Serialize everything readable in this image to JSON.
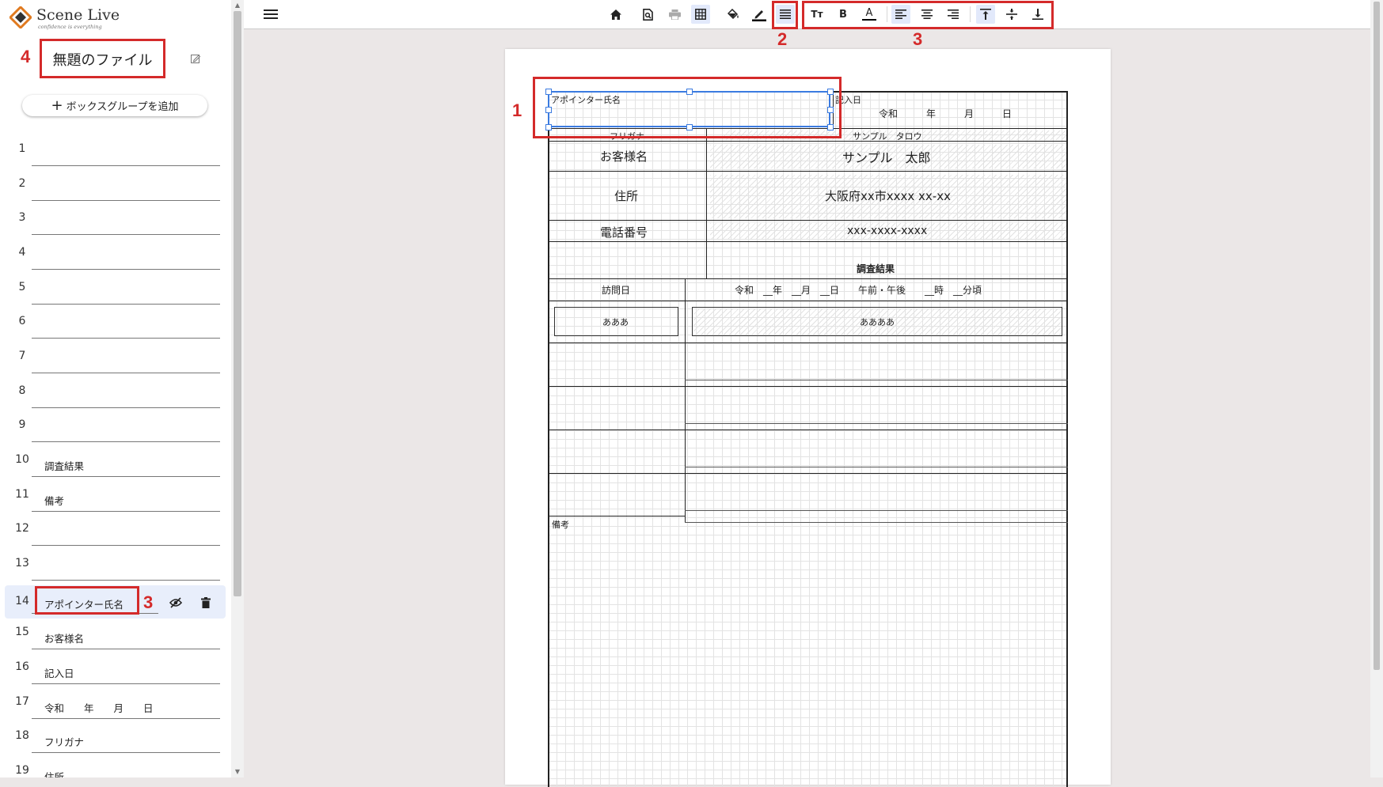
{
  "app": {
    "logo_name": "Scene Live",
    "logo_tagline": "confidence is everything"
  },
  "sidebar": {
    "file_title": "無題のファイル",
    "add_group_label": "ボックスグループを追加",
    "rows": [
      {
        "num": "1",
        "value": ""
      },
      {
        "num": "2",
        "value": ""
      },
      {
        "num": "3",
        "value": ""
      },
      {
        "num": "4",
        "value": ""
      },
      {
        "num": "5",
        "value": ""
      },
      {
        "num": "6",
        "value": ""
      },
      {
        "num": "7",
        "value": ""
      },
      {
        "num": "8",
        "value": ""
      },
      {
        "num": "9",
        "value": ""
      },
      {
        "num": "10",
        "value": "調査結果"
      },
      {
        "num": "11",
        "value": "備考"
      },
      {
        "num": "12",
        "value": ""
      },
      {
        "num": "13",
        "value": ""
      },
      {
        "num": "14",
        "value": "アポインター氏名"
      },
      {
        "num": "15",
        "value": "お客様名"
      },
      {
        "num": "16",
        "value": "記入日"
      },
      {
        "num": "17",
        "value": "令和　　年　　月　　日"
      },
      {
        "num": "18",
        "value": "フリガナ"
      },
      {
        "num": "19",
        "value": "住所"
      }
    ]
  },
  "callouts": {
    "c1": "1",
    "c2": "2",
    "c3": "3",
    "c3b": "3",
    "c4": "4"
  },
  "toolbar": {
    "icons": [
      "menu-icon",
      "home-icon",
      "preview-icon",
      "print-icon",
      "grid-icon",
      "fill-color-icon",
      "line-color-icon",
      "line-style-icon",
      "font-size-icon",
      "bold-icon",
      "font-color-icon",
      "align-left-icon",
      "align-center-icon",
      "align-right-icon",
      "valign-top-icon",
      "valign-middle-icon",
      "valign-bottom-icon"
    ],
    "font_size_glyph": "Tт",
    "bold_glyph": "B",
    "font_color_glyph": "A"
  },
  "form": {
    "appointer_label": "アポインター氏名",
    "entry_date_label": "記入日",
    "entry_date_value": "令和　　　年　　　月　　　日",
    "furigana_label": "フリガナ",
    "furigana_value": "サンプル　タロウ",
    "customer_label": "お客様名",
    "customer_value": "サンプル　太郎",
    "address_label": "住所",
    "address_value": "大阪府xx市xxxx xx-xx",
    "phone_label": "電話番号",
    "phone_value": "xxx-xxxx-xxxx",
    "survey_title": "調査結果",
    "visit_label": "訪問日",
    "visit_value": "令和　__年　__月　__日　　午前・午後　　__時　__分頃",
    "box1_value": "あああ",
    "box2_value": "ああああ",
    "remarks_label": "備考"
  },
  "colors": {
    "callout": "#d42a2a",
    "selection": "#3b7be0",
    "active_row": "#e8eefb",
    "canvas_bg": "#ebe7e7"
  }
}
